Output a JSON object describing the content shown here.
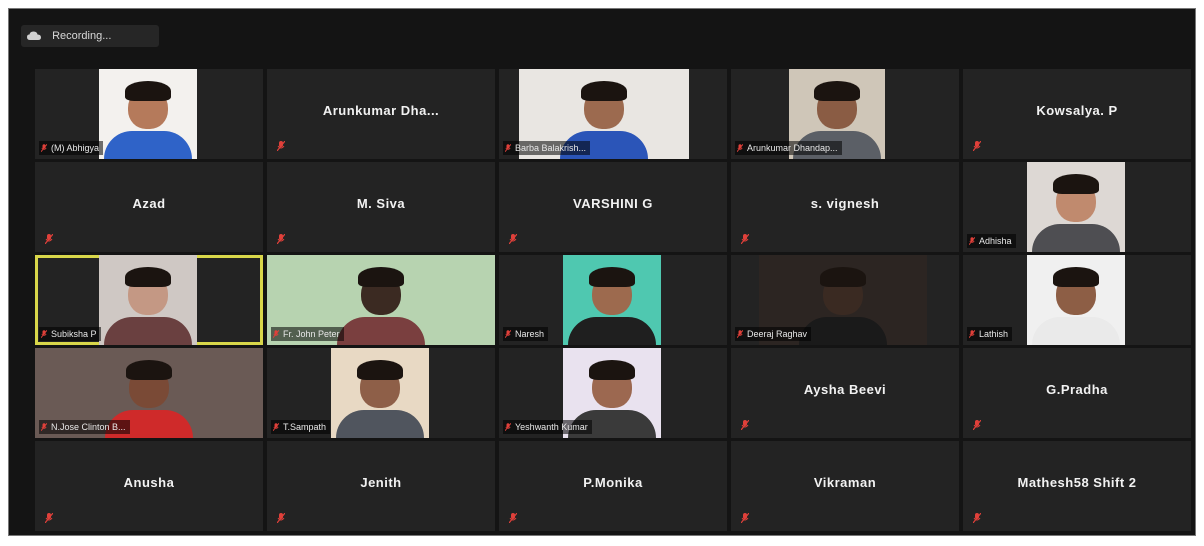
{
  "recording": {
    "text": "Recording..."
  },
  "colors": {
    "tile_bg": "#232323",
    "app_bg": "#141414",
    "active_speaker": "#d9d74a",
    "muted": "#e0403a"
  },
  "participants": [
    {
      "name": "",
      "label": "(M) Abhigya",
      "video": true
    },
    {
      "name": "Arunkumar Dha...",
      "label": "",
      "video": false
    },
    {
      "name": "",
      "label": "Barba Balakrish...",
      "video": true
    },
    {
      "name": "",
      "label": "Arunkumar Dhandap...",
      "video": true
    },
    {
      "name": "Kowsalya. P",
      "label": "",
      "video": false
    },
    {
      "name": "Azad",
      "label": "",
      "video": false
    },
    {
      "name": "M. Siva",
      "label": "",
      "video": false
    },
    {
      "name": "VARSHINI G",
      "label": "",
      "video": false
    },
    {
      "name": "s. vignesh",
      "label": "",
      "video": false
    },
    {
      "name": "",
      "label": "Adhisha",
      "video": true
    },
    {
      "name": "",
      "label": "Subiksha P",
      "video": true,
      "active": true
    },
    {
      "name": "",
      "label": "Fr. John Peter",
      "video": true
    },
    {
      "name": "",
      "label": "Naresh",
      "video": true
    },
    {
      "name": "",
      "label": "Deeraj Raghav",
      "video": true
    },
    {
      "name": "",
      "label": "Lathish",
      "video": true
    },
    {
      "name": "",
      "label": "N.Jose Clinton B...",
      "video": true
    },
    {
      "name": "",
      "label": "T.Sampath",
      "video": true
    },
    {
      "name": "",
      "label": "Yeshwanth Kumar",
      "video": true
    },
    {
      "name": "Aysha Beevi",
      "label": "",
      "video": false
    },
    {
      "name": "G.Pradha",
      "label": "",
      "video": false
    },
    {
      "name": "Anusha",
      "label": "",
      "video": false
    },
    {
      "name": "Jenith",
      "label": "",
      "video": false
    },
    {
      "name": "P.Monika",
      "label": "",
      "video": false
    },
    {
      "name": "Vikraman",
      "label": "",
      "video": false
    },
    {
      "name": "Mathesh58 Shift 2",
      "label": "",
      "video": false
    }
  ]
}
